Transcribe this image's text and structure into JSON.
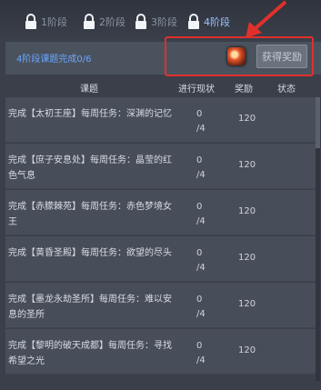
{
  "stages": [
    {
      "label": "1阶段",
      "active": false
    },
    {
      "label": "2阶段",
      "active": false
    },
    {
      "label": "3阶段",
      "active": false
    },
    {
      "label": "4阶段",
      "active": true
    }
  ],
  "progress": {
    "text": "4阶段课题完成0/6"
  },
  "reward_button": {
    "label": "获得奖励"
  },
  "columns": {
    "task": "课题",
    "progress": "进行现状",
    "reward": "奖励",
    "status": "状态"
  },
  "rows": [
    {
      "task": "完成【太初王座】每周任务：深渊的记忆",
      "progress_value": "0",
      "progress_total": "/4",
      "reward": "120",
      "status": ""
    },
    {
      "task": "完成【庶子安息处】每周任务：晶莹的红色气息",
      "progress_value": "0",
      "progress_total": "/4",
      "reward": "120",
      "status": ""
    },
    {
      "task": "完成【赤朦棘苑】每周任务：赤色梦境女王",
      "progress_value": "0",
      "progress_total": "/4",
      "reward": "120",
      "status": ""
    },
    {
      "task": "完成【黄昏圣殿】每周任务：欲望的尽头",
      "progress_value": "0",
      "progress_total": "/4",
      "reward": "120",
      "status": ""
    },
    {
      "task": "完成【墨龙永劫圣所】每周任务：难以安息的圣所",
      "progress_value": "0",
      "progress_total": "/4",
      "reward": "120",
      "status": ""
    },
    {
      "task": "完成【黎明的破天成都】每周任务：寻找希望之光",
      "progress_value": "0",
      "progress_total": "/4",
      "reward": "120",
      "status": ""
    }
  ],
  "colors": {
    "accent_blue": "#6aa6ff",
    "annotation_red": "#e0302b"
  }
}
